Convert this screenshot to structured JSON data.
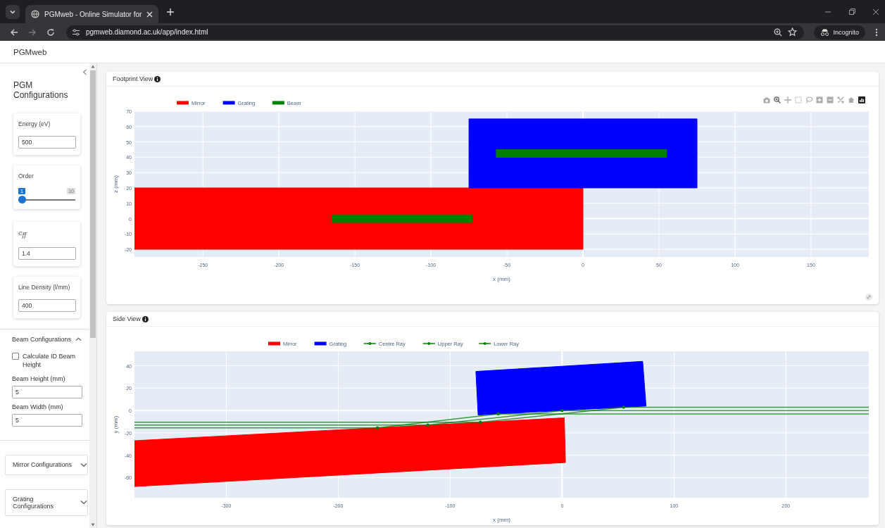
{
  "browser": {
    "tab_title": "PGMweb - Online Simulator for",
    "url": "pgmweb.diamond.ac.uk/app/index.html",
    "profile": "Incognito"
  },
  "app": {
    "title": "PGMweb"
  },
  "sidebar": {
    "heading": "PGM Configurations",
    "cards": [
      {
        "kind": "input",
        "label": "Energy (eV)",
        "value": "500"
      },
      {
        "kind": "slider",
        "label": "Order",
        "value_label": "1",
        "max_label": "10",
        "level": 0
      },
      {
        "kind": "math_input",
        "label": "c$_{ff}$",
        "value": "1.4"
      },
      {
        "kind": "input",
        "label": "Line Density (l/mm)",
        "value": "400"
      }
    ],
    "sections": [
      {
        "title": "Beam Configurations",
        "expanded": true,
        "checkbox": {
          "label": "Calculate ID Beam Height",
          "checked": false
        },
        "fields": [
          {
            "label": "Beam Height (mm)",
            "value": "5"
          },
          {
            "label": "Beam Width (mm)",
            "value": "5"
          }
        ]
      },
      {
        "title": "Mirror Configurations",
        "expanded": false
      },
      {
        "title": "Grating Configurations",
        "expanded": false
      }
    ]
  },
  "panels": [
    {
      "title": "Footprint View",
      "modebar": true,
      "chart_data": {
        "type": "area",
        "grid": true,
        "legend": true,
        "xlabel": "x (mm)",
        "ylabel": "z (mm)",
        "xlim": [
          -295,
          188
        ],
        "ylim": [
          -25,
          70
        ],
        "xticks": [
          -250,
          -200,
          -150,
          -100,
          -50,
          0,
          50,
          100,
          150
        ],
        "yticks": [
          -20,
          -10,
          0,
          10,
          20,
          30,
          40,
          50,
          60,
          70
        ],
        "series": [
          {
            "name": "Mirror",
            "color": "#ff0000",
            "x": [
              -295,
              0,
              0,
              -295,
              -295
            ],
            "values": [
              -20,
              -20,
              20,
              20,
              -20
            ]
          },
          {
            "name": "Grating",
            "color": "#0000ff",
            "x": [
              -75,
              75,
              75,
              -75,
              -75
            ],
            "values": [
              20,
              20,
              65,
              65,
              20
            ]
          },
          {
            "name": "Beam",
            "color": "#008000",
            "x": [
              -165,
              -73,
              -73,
              -165,
              -165,
              null,
              -57,
              55,
              55,
              -57,
              -57
            ],
            "values": [
              -2.5,
              -2.5,
              2.5,
              2.5,
              -2.5,
              null,
              40,
              40,
              45,
              45,
              40
            ]
          }
        ]
      }
    },
    {
      "title": "Side View",
      "modebar": false,
      "chart_data": {
        "type": "line",
        "grid": true,
        "legend": true,
        "xlabel": "x (mm)",
        "ylabel": "y (mm)",
        "xlim": [
          -382,
          274
        ],
        "ylim": [
          -78,
          53
        ],
        "xticks": [
          -300,
          -200,
          -100,
          0,
          100,
          200
        ],
        "yticks": [
          -60,
          -40,
          -20,
          0,
          20,
          40
        ],
        "series": [
          {
            "name": "Mirror",
            "type": "area",
            "color": "#ff0000",
            "x": [
              -382,
              2,
              3,
              -382,
              -382
            ],
            "values": [
              -27,
              -6.5,
              -46.5,
              -68,
              -27
            ]
          },
          {
            "name": "Grating",
            "type": "area",
            "color": "#0000ff",
            "x": [
              -77,
              72,
              75,
              -75,
              -77
            ],
            "values": [
              35,
              44,
              4,
              -4,
              35
            ]
          },
          {
            "name": "Centre Ray",
            "type": "line",
            "color": "#008000",
            "x": [
              -382,
              -120,
              0,
              274
            ],
            "values": [
              -13,
              -13,
              0,
              0
            ]
          },
          {
            "name": "Upper Ray",
            "type": "line",
            "color": "#008000",
            "x": [
              -382,
              -73,
              55,
              274
            ],
            "values": [
              -10.5,
              -10.5,
              3,
              3
            ]
          },
          {
            "name": "Lower Ray",
            "type": "line",
            "color": "#008000",
            "x": [
              -382,
              -165,
              -57,
              274
            ],
            "values": [
              -15.5,
              -15.5,
              -3,
              -3
            ]
          }
        ]
      }
    }
  ]
}
